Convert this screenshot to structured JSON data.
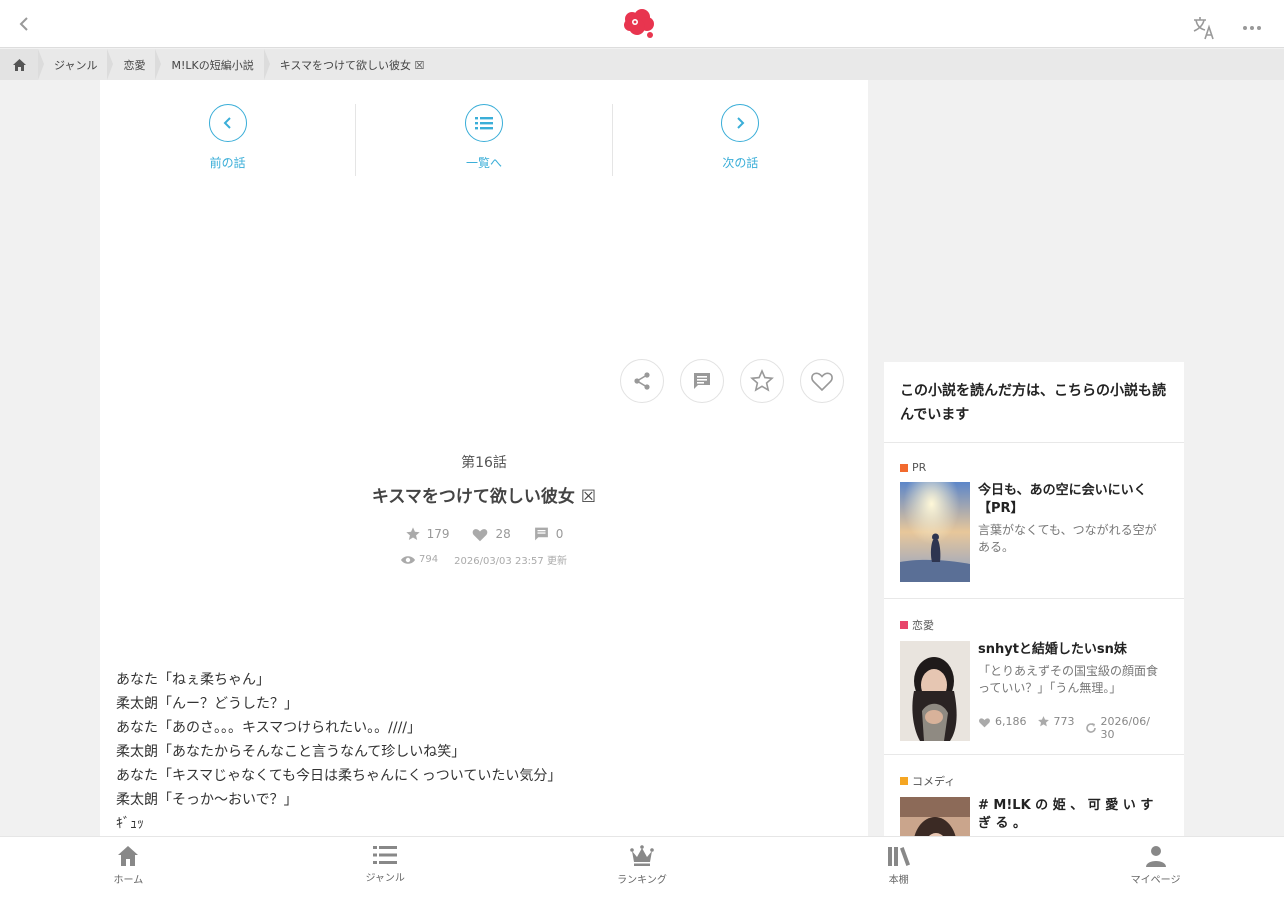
{
  "breadcrumb": {
    "items": [
      "ジャンル",
      "恋愛",
      "M!LKの短編小説",
      "キスマをつけて欲しい彼女 ☒"
    ]
  },
  "episode_nav": {
    "prev": "前の話",
    "list": "一覧へ",
    "next": "次の話"
  },
  "episode": {
    "number": "第16話",
    "title": "キスマをつけて欲しい彼女 ☒",
    "stars": "179",
    "likes": "28",
    "comments": "0",
    "views": "794",
    "updated": "2026/03/03 23:57 更新"
  },
  "body_lines": [
    "あなた「ねぇ柔ちゃん」",
    "柔太朗「んー？どうした？」",
    "あなた「あのさ。。。キスマつけられたい。。////」",
    "柔太朗「あなたからそんなこと言うなんて珍しいね笑」",
    "あなた「キスマじゃなくても今日は柔ちゃんにくっついていたい気分」",
    "柔太朗「そっか〜おいで？」",
    "ｷﾞｭｯ"
  ],
  "sidebar": {
    "heading": "この小説を読んだ方は、こちらの小説も読んでいます",
    "recs": [
      {
        "tag": "PR",
        "tag_color": "#f26a2e",
        "title": "今日も、あの空に会いにいく【PR】",
        "desc": "言葉がなくても、つながれる空がある。"
      },
      {
        "tag": "恋愛",
        "tag_color": "#e8456b",
        "title": "snhytと結婚したいsn妹",
        "desc": "「とりあえずその国宝級の顔面食っていい？」「うん無理。」",
        "likes": "6,186",
        "stars": "773",
        "date": "2026/06/30"
      },
      {
        "tag": "コメディ",
        "tag_color": "#f5a623",
        "title": "# M!LK の 姫 、 可 愛 い す ぎ る 。",
        "desc": ""
      }
    ]
  },
  "bottom_nav": {
    "home": "ホーム",
    "genre": "ジャンル",
    "ranking": "ランキング",
    "shelf": "本棚",
    "mypage": "マイページ"
  },
  "colors": {
    "accent": "#3aaed8",
    "logo": "#e8354f"
  }
}
